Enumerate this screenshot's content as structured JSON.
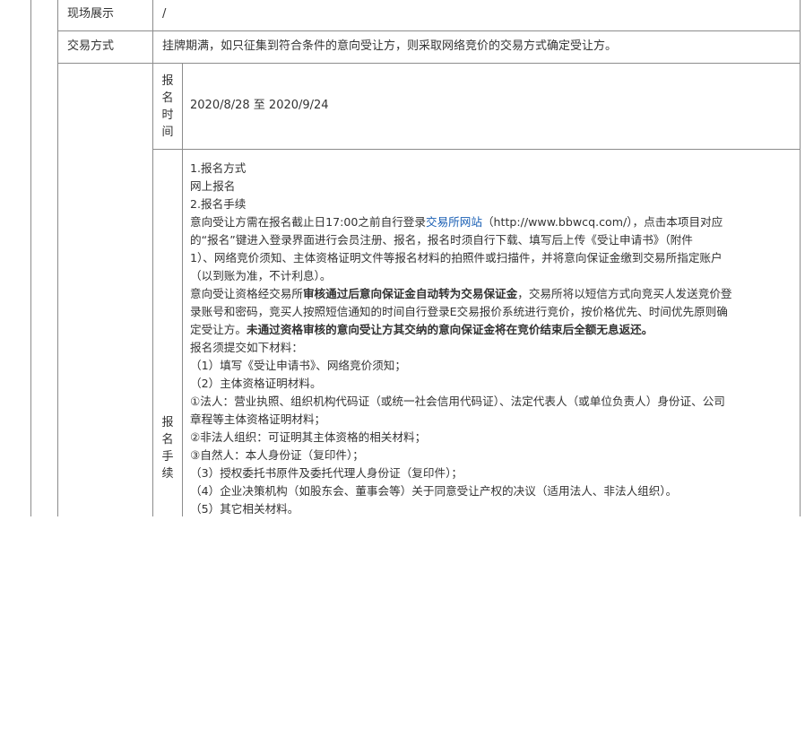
{
  "rows": {
    "display": {
      "label": "现场展示",
      "value": "/"
    },
    "trade_method": {
      "label": "交易方式",
      "value": "挂牌期满，如只征集到符合条件的意向受让方，则采取网络竞价的交易方式确定受让方。"
    },
    "reg_time": {
      "label": [
        "报",
        "名",
        "时",
        "间"
      ],
      "value": "2020/8/28 至 2020/9/24"
    },
    "reg_procedure": {
      "label": [
        "报",
        "名",
        "手",
        "续"
      ]
    }
  },
  "procedure": {
    "l1": "1.报名方式",
    "l2": "网上报名",
    "l3": "2.报名手续",
    "l4_a": "意向受让方需在报名截止日17:00之前自行登录",
    "l4_link": "交易所网站",
    "l4_b": "（http://www.bbwcq.com/），点击本项目对应",
    "l5": "的“报名”键进入登录界面进行会员注册、报名，报名时须自行下载、填写后上传《受让申请书》（附件",
    "l6": "1）、网络竞价须知、主体资格证明文件等报名材料的拍照件或扫描件，并将意向保证金缴到交易所指定账户",
    "l7": "（以到账为准，不计利息）。",
    "l8_a": "意向受让资格经交易所",
    "l8_bold": "审核通过后意向保证金自动转为交易保证金",
    "l8_b": "，交易所将以短信方式向竞买人发送竞价登",
    "l9": "录账号和密码，竞买人按照短信通知的时间自行登录E交易报价系统进行竞价，按价格优先、时间优先原则确",
    "l10_a": "定受让方。",
    "l10_bold": "未通过资格审核的意向受让方其交纳的意向保证金将在竞价结束后全额无息返还。",
    "l11": "报名须提交如下材料：",
    "l12": "（1）填写《受让申请书》、网络竞价须知；",
    "l13": "（2）主体资格证明材料。",
    "l14": "①法人：营业执照、组织机构代码证（或统一社会信用代码证）、法定代表人（或单位负责人）身份证、公司",
    "l15": "章程等主体资格证明材料；",
    "l16": "②非法人组织：可证明其主体资格的相关材料；",
    "l17": "③自然人：本人身份证（复印件）；",
    "l18": "（3）授权委托书原件及委托代理人身份证（复印件）；",
    "l19": "（4）企业决策机构（如股东会、董事会等）关于同意受让产权的决议（适用法人、非法人组织）。",
    "l20": "（5）其它相关材料。"
  },
  "colors": {
    "border": "#8c8c8c",
    "text": "#333333",
    "link": "#1a5fb4"
  }
}
